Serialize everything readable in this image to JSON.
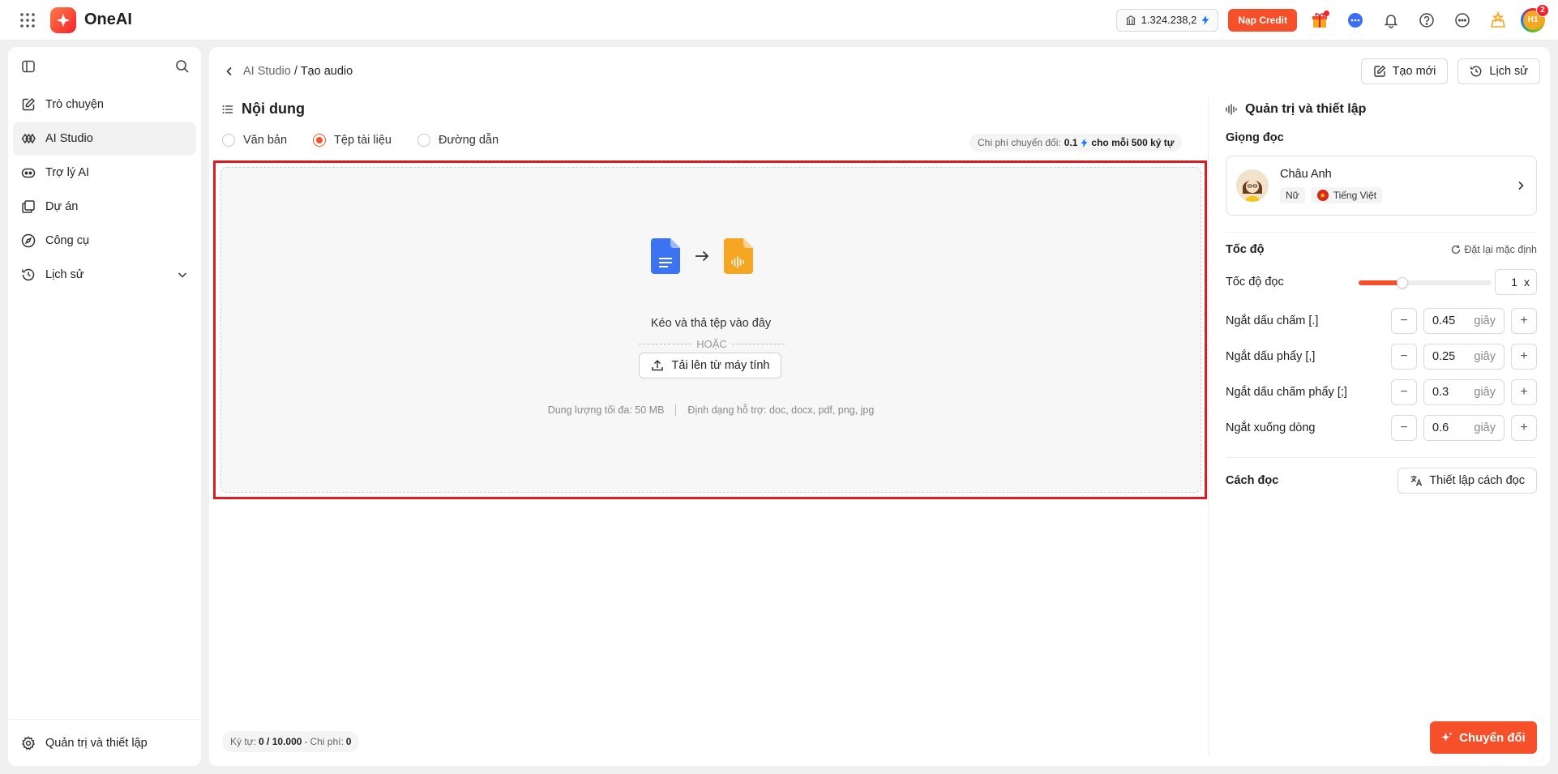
{
  "app": {
    "name": "OneAI"
  },
  "topbar": {
    "balance": "1.324.238,2",
    "topup_label": "Nạp Credit",
    "notifications_count": "2",
    "avatar_initials": "H1"
  },
  "sidebar": {
    "items": [
      {
        "label": "Trò chuyện",
        "icon": "chat-edit-icon"
      },
      {
        "label": "AI Studio",
        "icon": "studio-icon"
      },
      {
        "label": "Trợ lý AI",
        "icon": "robot-icon"
      },
      {
        "label": "Dự án",
        "icon": "folder-icon"
      },
      {
        "label": "Công cụ",
        "icon": "compass-icon"
      },
      {
        "label": "Lịch sử",
        "icon": "history-icon"
      }
    ],
    "footer_label": "Quản trị và thiết lập"
  },
  "breadcrumb": {
    "parent": "AI Studio",
    "separator": "/",
    "current": "Tạo audio"
  },
  "header_buttons": {
    "new_label": "Tạo mới",
    "history_label": "Lịch sử"
  },
  "content": {
    "title": "Nội dung",
    "source_options": [
      {
        "label": "Văn bản",
        "selected": false
      },
      {
        "label": "Tệp tài liệu",
        "selected": true
      },
      {
        "label": "Đường dẫn",
        "selected": false
      }
    ],
    "cost": {
      "prefix": "Chi phí chuyển đổi:",
      "value": "0.1",
      "suffix": "cho mỗi 500 ký tự"
    },
    "dropzone": {
      "title": "Kéo và thả tệp vào đây",
      "or": "HOẶC",
      "upload_label": "Tải lên từ máy tính",
      "max_size": "Dung lượng tối đa: 50 MB",
      "formats": "Định dạng hỗ trợ: doc, docx, pdf, png, jpg"
    },
    "counter": {
      "chars_label": "Ký tự:",
      "chars_value": "0 / 10.000",
      "dash": "-",
      "cost_label": "Chi phí:",
      "cost_value": "0"
    }
  },
  "settings": {
    "title": "Quản trị và thiết lập",
    "voice_label": "Giọng đọc",
    "voice": {
      "name": "Châu Anh",
      "gender": "Nữ",
      "language": "Tiếng Việt"
    },
    "speed_label": "Tốc độ",
    "reset_label": "Đặt lại mặc định",
    "reading_speed": {
      "label": "Tốc độ đọc",
      "value": "1",
      "unit": "x",
      "fraction": 0.33
    },
    "pauses": [
      {
        "label": "Ngắt dấu chấm [.]",
        "value": "0.45",
        "unit": "giây"
      },
      {
        "label": "Ngắt dấu phẩy [,]",
        "value": "0.25",
        "unit": "giây"
      },
      {
        "label": "Ngắt dấu chấm phẩy [;]",
        "value": "0.3",
        "unit": "giây"
      },
      {
        "label": "Ngắt xuống dòng",
        "value": "0.6",
        "unit": "giây"
      }
    ],
    "reading_style_label": "Cách đọc",
    "reading_style_button": "Thiết lập cách đọc",
    "convert_label": "Chuyển đổi"
  },
  "colors": {
    "accent": "#f5502a",
    "highlight": "#e01b22"
  }
}
